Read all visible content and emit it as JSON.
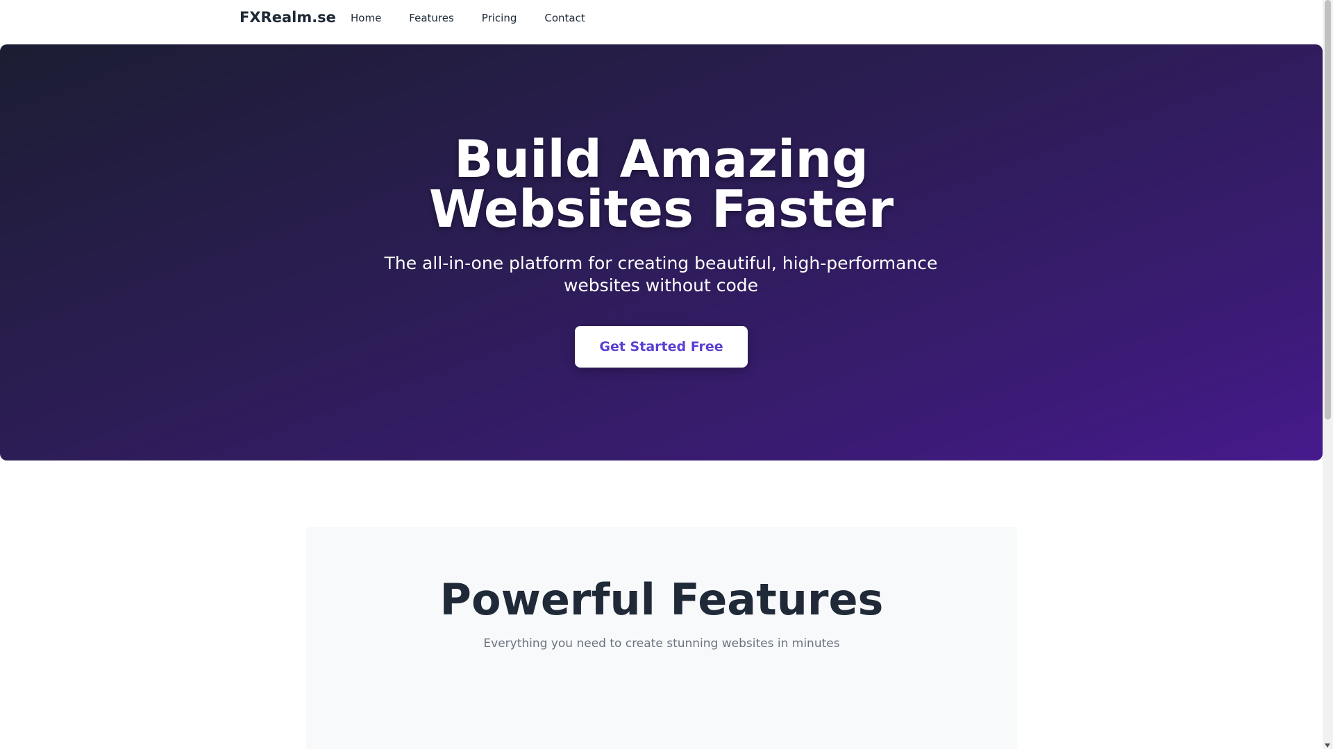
{
  "nav": {
    "brand": "FXRealm.se",
    "links": [
      "Home",
      "Features",
      "Pricing",
      "Contact"
    ]
  },
  "hero": {
    "title_line1": "Build Amazing",
    "title_line2": "Websites Faster",
    "subtitle": "The all-in-one platform for creating beautiful, high-performance websites without code",
    "cta_label": "Get Started Free"
  },
  "features": {
    "title": "Powerful Features",
    "subtitle": "Everything you need to create stunning websites in minutes"
  },
  "colors": {
    "hero_gradient_start": "#1c1d33",
    "hero_gradient_end": "#461a8c",
    "cta_text": "#5b3fd1",
    "heading_text": "#1f2937"
  }
}
